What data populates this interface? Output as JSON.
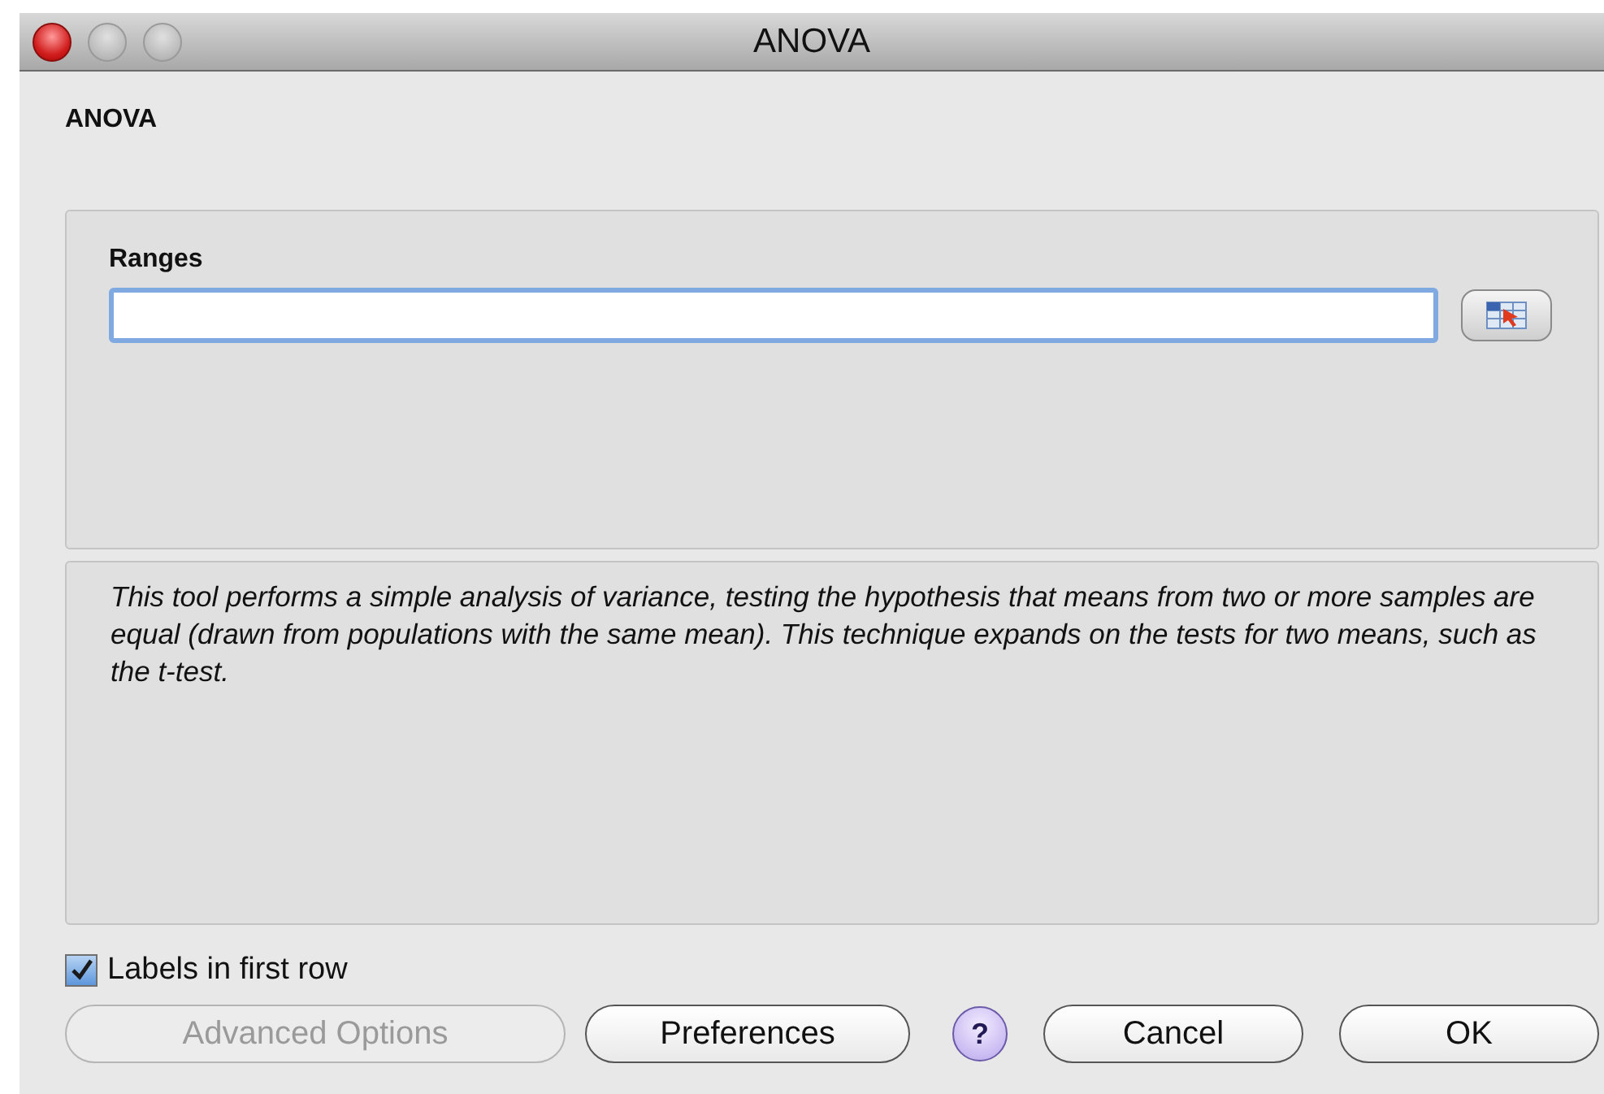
{
  "window": {
    "title": "ANOVA",
    "heading": "ANOVA"
  },
  "ranges": {
    "label": "Ranges"
  },
  "description": "This tool performs a simple analysis of variance, testing the hypothesis that means from two or more samples are equal (drawn from populations with the same mean). This technique expands on the tests for two means, such as the t-test.",
  "labels_checkbox": {
    "label": "Labels in first row",
    "checked": true
  },
  "buttons": [
    {
      "kind": "button",
      "label": "Advanced Options",
      "disabled": true
    },
    {
      "kind": "button",
      "label": "Preferences",
      "disabled": false
    },
    {
      "kind": "help",
      "label": "?",
      "disabled": false
    },
    {
      "kind": "button",
      "label": "Cancel",
      "disabled": false
    },
    {
      "kind": "button",
      "label": "OK",
      "disabled": false
    }
  ]
}
